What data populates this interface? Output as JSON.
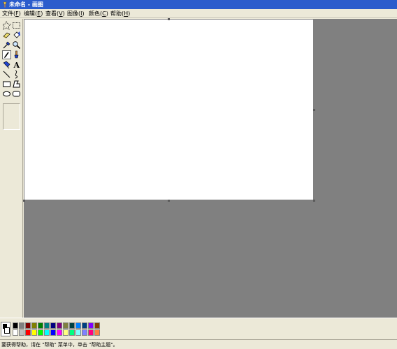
{
  "window": {
    "title": "未命名 - 画图"
  },
  "menu": [
    {
      "label": "文件",
      "key": "F"
    },
    {
      "label": "编辑",
      "key": "E"
    },
    {
      "label": "查看",
      "key": "V"
    },
    {
      "label": "图像",
      "key": "I"
    },
    {
      "label": "颜色",
      "key": "C"
    },
    {
      "label": "帮助",
      "key": "H"
    }
  ],
  "tools": [
    {
      "name": "free-form-select",
      "icon": "free-form-select-icon"
    },
    {
      "name": "rectangle-select",
      "icon": "rectangle-select-icon"
    },
    {
      "name": "eraser",
      "icon": "eraser-icon"
    },
    {
      "name": "fill",
      "icon": "paint-bucket-icon"
    },
    {
      "name": "pick-color",
      "icon": "eyedropper-icon"
    },
    {
      "name": "magnifier",
      "icon": "magnifier-icon"
    },
    {
      "name": "pencil",
      "icon": "pencil-icon",
      "active": true
    },
    {
      "name": "brush",
      "icon": "brush-icon"
    },
    {
      "name": "airbrush",
      "icon": "airbrush-icon"
    },
    {
      "name": "text",
      "icon": "text-icon",
      "glyph": "A"
    },
    {
      "name": "line",
      "icon": "line-icon"
    },
    {
      "name": "curve",
      "icon": "curve-icon"
    },
    {
      "name": "rectangle",
      "icon": "rectangle-icon"
    },
    {
      "name": "polygon",
      "icon": "polygon-icon"
    },
    {
      "name": "ellipse",
      "icon": "ellipse-icon"
    },
    {
      "name": "rounded-rectangle",
      "icon": "rounded-rectangle-icon"
    }
  ],
  "palette": {
    "foreground": "#000000",
    "background": "#ffffff",
    "top_row": [
      "#000000",
      "#808080",
      "#800000",
      "#808000",
      "#008000",
      "#008080",
      "#000080",
      "#800080",
      "#808040",
      "#004040",
      "#0080ff",
      "#004080",
      "#8000ff",
      "#804000"
    ],
    "bottom_row": [
      "#ffffff",
      "#c0c0c0",
      "#ff0000",
      "#ffff00",
      "#00ff00",
      "#00ffff",
      "#0000ff",
      "#ff00ff",
      "#ffff80",
      "#00ff80",
      "#80ffff",
      "#8080ff",
      "#ff0080",
      "#ff8040"
    ]
  },
  "status": {
    "text": "要获得帮助，请在 \"帮助\" 菜单中，单击 \"帮助主题\"。"
  },
  "colors": {
    "titlebar": "#2b5ccc",
    "workspace": "#808080",
    "canvas": "#ffffff",
    "chrome": "#ece9d8"
  }
}
